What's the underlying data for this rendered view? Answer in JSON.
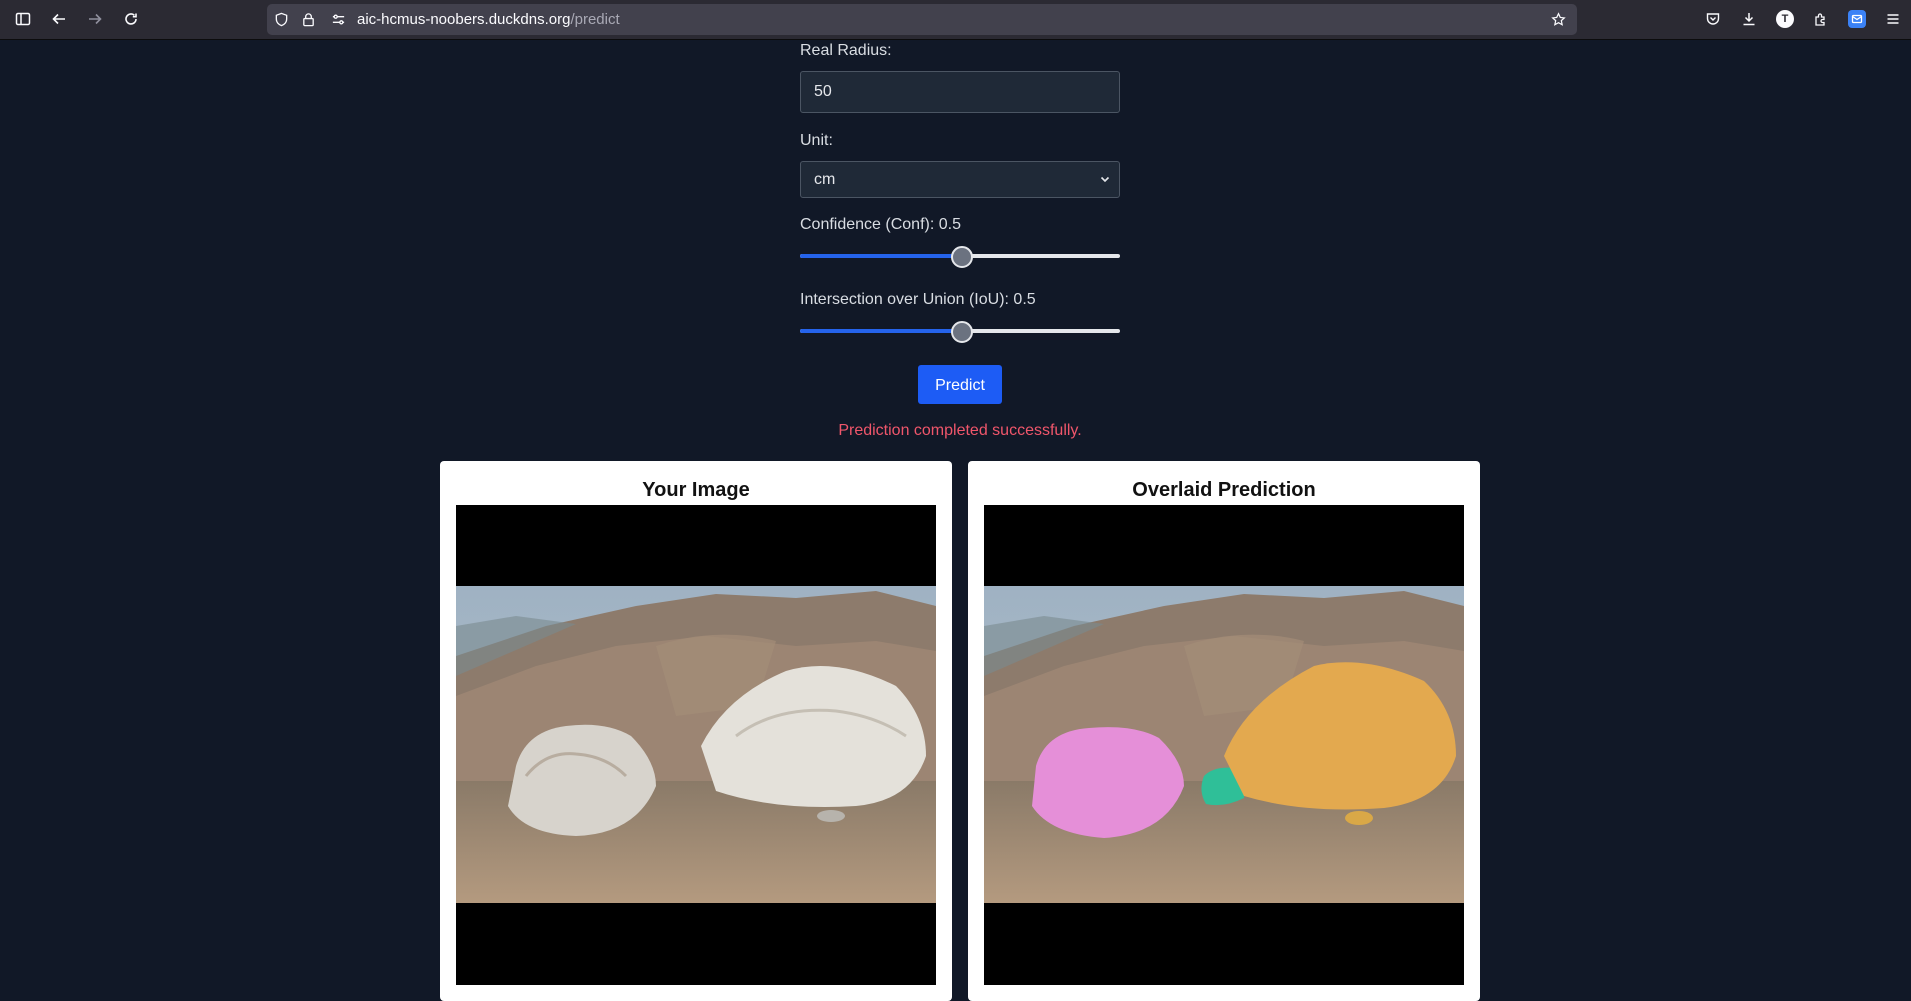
{
  "browser": {
    "url_host": "aic-hcmus-noobers.duckdns.org",
    "url_path": "/predict",
    "profile_initial": "T"
  },
  "form": {
    "radius_label": "Real Radius:",
    "radius_value": "50",
    "unit_label": "Unit:",
    "unit_value": "cm",
    "conf_label": "Confidence (Conf): 0.5",
    "conf_value": 0.5,
    "iou_label": "Intersection over Union (IoU): 0.5",
    "iou_value": 0.5,
    "predict_label": "Predict",
    "status_text": "Prediction completed successfully.",
    "status_color": "#f0566b"
  },
  "results": {
    "original_title": "Your Image",
    "overlay_title": "Overlaid Prediction",
    "mask_colors": [
      "#e58fd8",
      "#2fbf98",
      "#e3a94f",
      "#d9a847"
    ]
  },
  "colors": {
    "page_bg": "#111827",
    "accent": "#1d5cf5"
  }
}
